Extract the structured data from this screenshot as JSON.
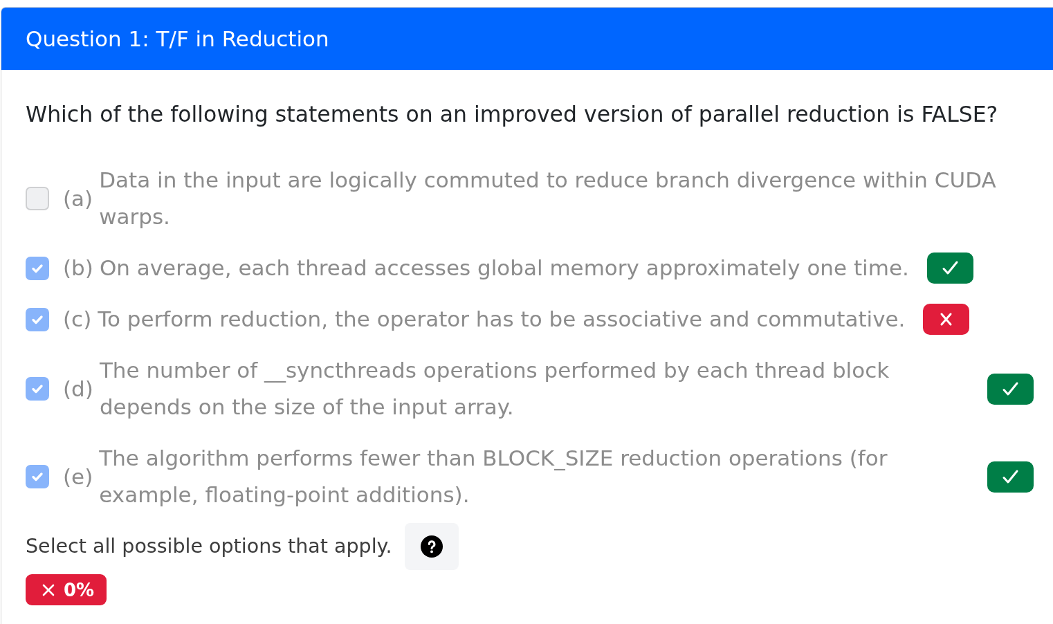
{
  "question": {
    "title": "Question 1: T/F in Reduction",
    "prompt": "Which of the following statements on an improved version of parallel reduction is FALSE?"
  },
  "options": [
    {
      "letter": "(a)",
      "text": "Data in the input are logically commuted to reduce branch divergence within CUDA warps.",
      "checked": false,
      "disabled": true
    },
    {
      "letter": "(b)",
      "text": "On average, each thread accesses global memory approximately one time.",
      "checked": true,
      "disabled": true,
      "correct": true
    },
    {
      "letter": "(c)",
      "text": "To perform reduction, the operator has to be associative and commutative.",
      "checked": true,
      "disabled": true,
      "correct": false
    },
    {
      "letter": "(d)",
      "text": "The number of __syncthreads operations performed by each thread block depends on the size of the input array.",
      "checked": true,
      "disabled": true,
      "correct": true
    },
    {
      "letter": "(e)",
      "text": "The algorithm performs fewer than BLOCK_SIZE reduction operations (for example, floating-point additions).",
      "checked": true,
      "disabled": true,
      "correct": true
    }
  ],
  "instructions": "Select all possible options that apply.",
  "score": {
    "text": "0%",
    "kind": "incorrect"
  }
}
